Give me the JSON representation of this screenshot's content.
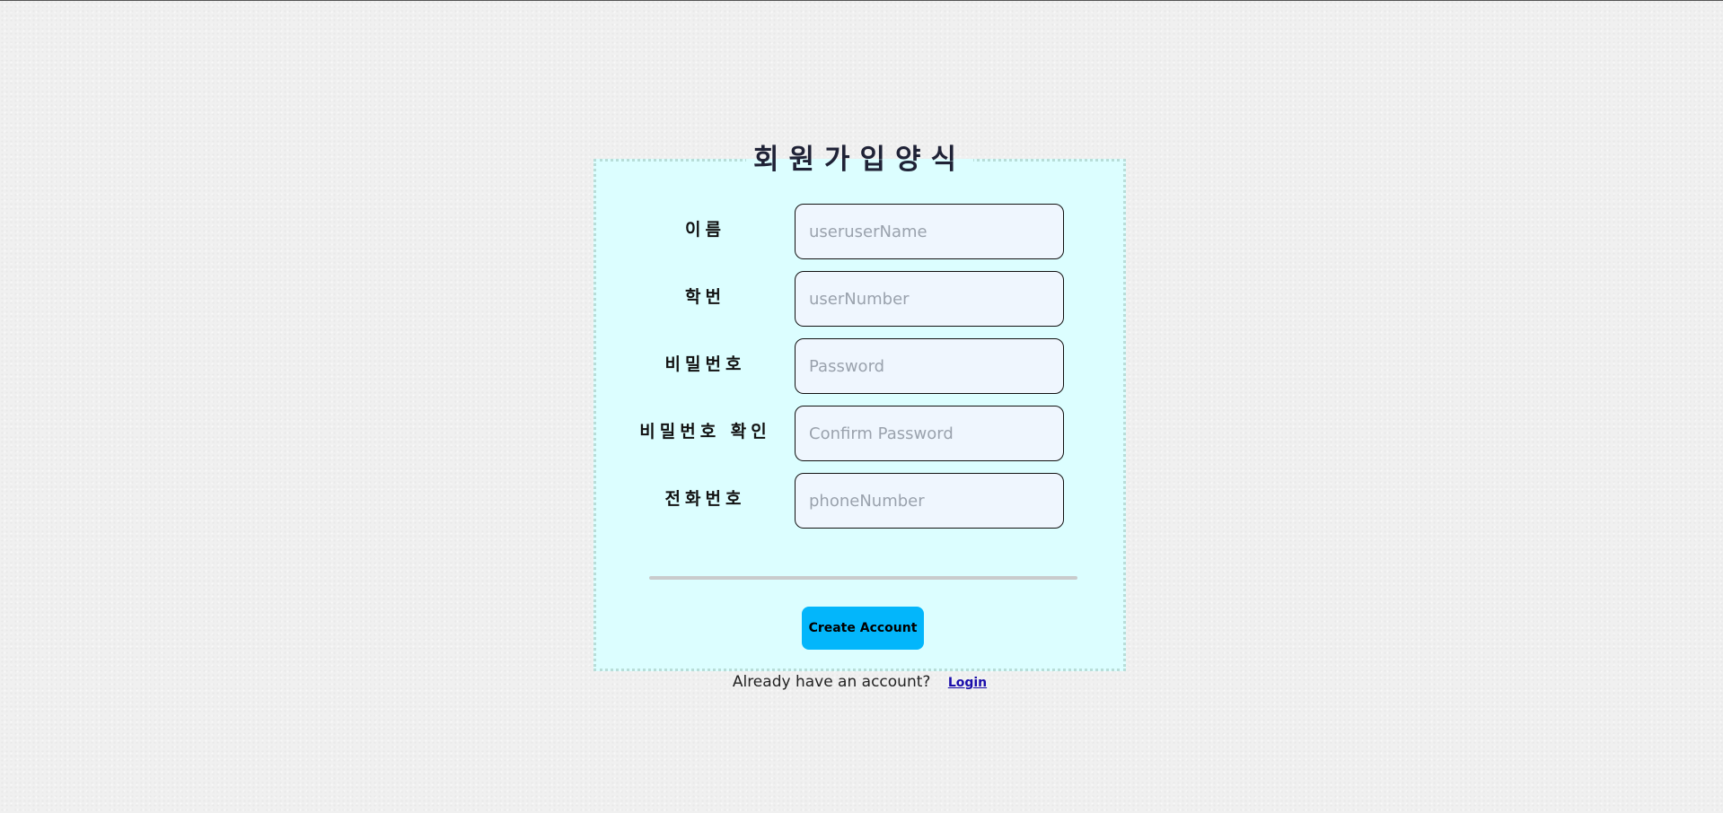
{
  "form": {
    "title": "회원가입양식",
    "fields": [
      {
        "label": "이름",
        "placeholder": "useruserName",
        "type": "text"
      },
      {
        "label": "학번",
        "placeholder": "userNumber",
        "type": "text"
      },
      {
        "label": "비밀번호",
        "placeholder": "Password",
        "type": "password"
      },
      {
        "label": "비밀번호 확인",
        "placeholder": "Confirm Password",
        "type": "password"
      },
      {
        "label": "전화번호",
        "placeholder": "phoneNumber",
        "type": "text"
      }
    ],
    "submit_label": "Create Account",
    "login_prompt": "Already have an account?",
    "login_link": "Login"
  },
  "colors": {
    "page_background": "#f0f0f0",
    "form_background": "#dcfeff",
    "form_border": "#b8ddd8",
    "input_background": "#eff6fe",
    "button_background": "#03b6fb",
    "link": "#1a0dab"
  }
}
